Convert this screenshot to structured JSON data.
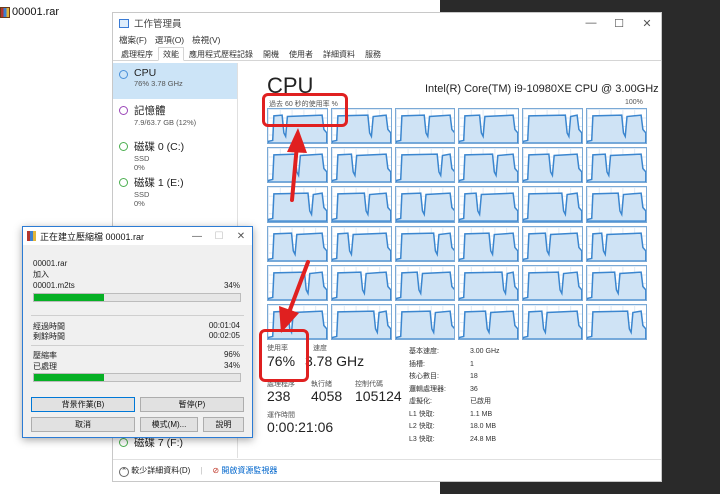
{
  "desktop": {
    "file_name": "00001.rar"
  },
  "task_manager": {
    "title": "工作管理員",
    "menu": [
      "檔案(F)",
      "選項(O)",
      "檢視(V)"
    ],
    "tabs": [
      "處理程序",
      "效能",
      "應用程式歷程記錄",
      "開機",
      "使用者",
      "詳細資料",
      "服務"
    ],
    "active_tab": "效能",
    "sidebar": [
      {
        "name": "CPU",
        "sub1": "76%  3.78 GHz",
        "sub2": "",
        "color": "#4a90d9"
      },
      {
        "name": "記憶體",
        "sub1": "7.9/63.7 GB (12%)",
        "sub2": "",
        "color": "#9b46b8"
      },
      {
        "name": "磁碟 0 (C:)",
        "sub1": "SSD",
        "sub2": "0%",
        "color": "#4caf50"
      },
      {
        "name": "磁碟 1 (E:)",
        "sub1": "SSD",
        "sub2": "0%",
        "color": "#4caf50"
      },
      {
        "name": "磁碟 7 (F:)",
        "sub1": "",
        "sub2": "",
        "color": "#4caf50"
      }
    ],
    "cpu": {
      "title": "CPU",
      "model": "Intel(R) Core(TM) i9-10980XE CPU @ 3.00GHz",
      "graph_caption": "過去 60 秒的使用率 %",
      "graph_max": "100%",
      "stats": {
        "utilization_label": "使用率",
        "utilization": "76%",
        "speed_label": "速度",
        "speed": "3.78 GHz",
        "processes_label": "處理程序",
        "processes": "238",
        "threads_label": "執行緒",
        "threads": "4058",
        "handles_label": "控制代碼",
        "handles": "105124",
        "uptime_label": "運作時間",
        "uptime": "0:00:21:06"
      },
      "specs": [
        {
          "k": "基本速度:",
          "v": "3.00 GHz"
        },
        {
          "k": "插槽:",
          "v": "1"
        },
        {
          "k": "核心數目:",
          "v": "18"
        },
        {
          "k": "邏輯處理器:",
          "v": "36"
        },
        {
          "k": "虛擬化:",
          "v": "已啟用"
        },
        {
          "k": "L1 快取:",
          "v": "1.1 MB"
        },
        {
          "k": "L2 快取:",
          "v": "18.0 MB"
        },
        {
          "k": "L3 快取:",
          "v": "24.8 MB"
        }
      ]
    },
    "footer": {
      "less_details": "較少詳細資料(D)",
      "resource_monitor": "開啟資源監視器"
    }
  },
  "winrar": {
    "title": "正在建立壓縮檔 00001.rar",
    "archive": "00001.rar",
    "action": "加入",
    "file": "00001.m2ts",
    "file_percent": "34%",
    "file_progress": 0.34,
    "elapsed_label": "經過時間",
    "elapsed": "00:01:04",
    "remaining_label": "剩餘時間",
    "remaining": "00:02:05",
    "ratio_label": "壓縮率",
    "ratio": "96%",
    "processed_label": "已處理",
    "processed": "34%",
    "total_progress": 0.34,
    "buttons": {
      "background": "背景作業(B)",
      "pause": "暫停(P)",
      "cancel": "取消",
      "mode": "模式(M)...",
      "help": "說明"
    }
  }
}
